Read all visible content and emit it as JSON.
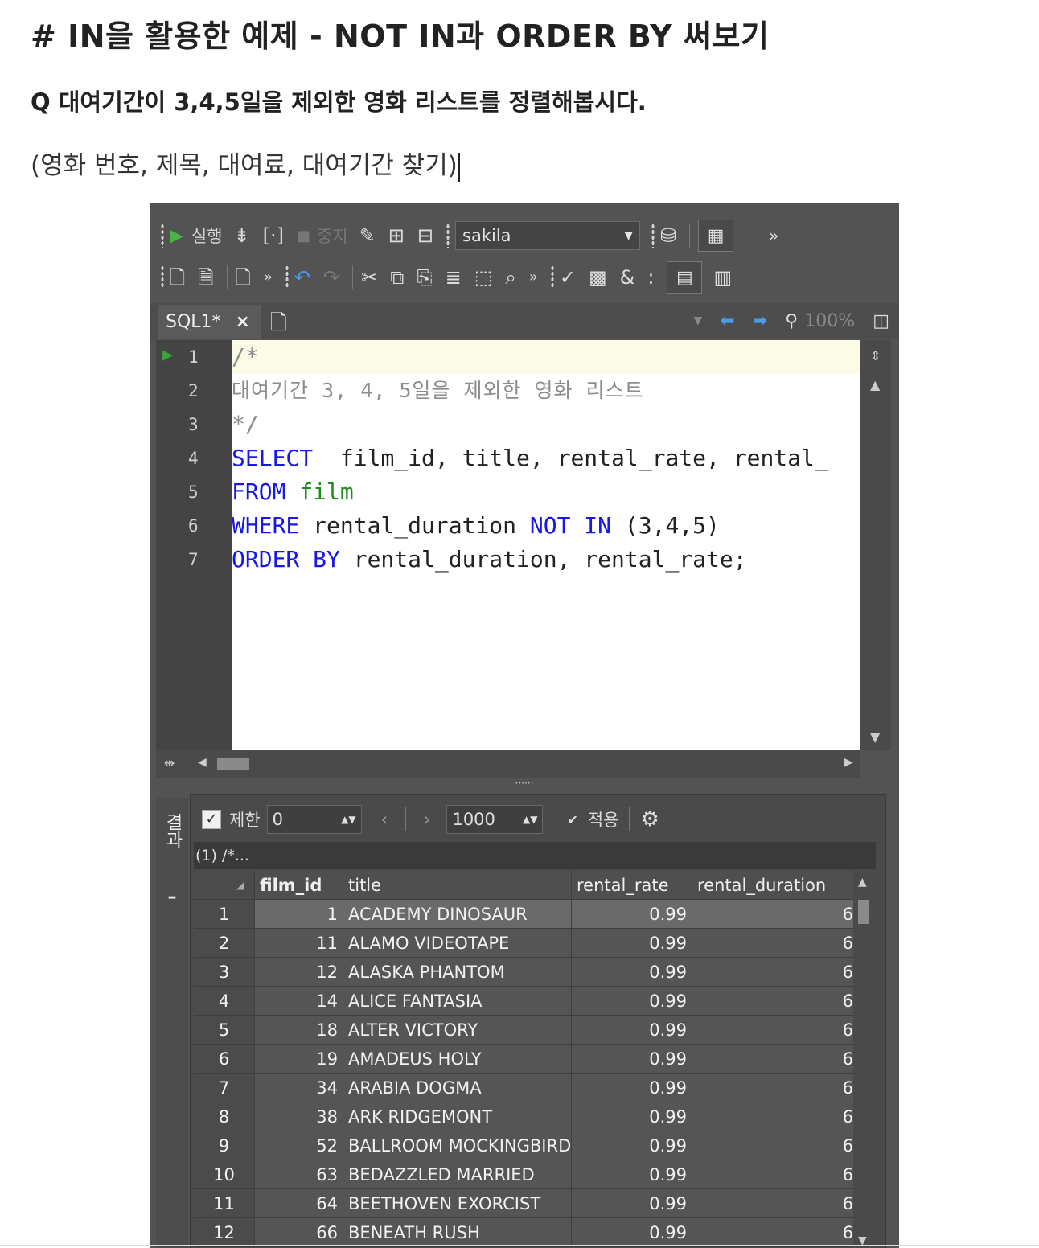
{
  "article": {
    "heading": "# IN을 활용한 예제 - NOT IN과 ORDER BY 써보기",
    "question": "Q 대여기간이 3,4,5일을 제외한 영화 리스트를 정렬해봅시다.",
    "note": "(영화 번호, 제목, 대여료, 대여기간 찾기)"
  },
  "toolbar": {
    "run_label": "실행",
    "stop_label": "중지",
    "database": "sakila",
    "more": "»"
  },
  "tabs": {
    "sql_tab": "SQL1*",
    "close": "×",
    "zoom": "100%"
  },
  "editor": {
    "line_numbers": [
      "1",
      "2",
      "3",
      "4",
      "5",
      "6",
      "7"
    ],
    "lines": {
      "l1": "/*",
      "l2": "대여기간 3, 4, 5일을 제외한 영화 리스트",
      "l3": "*/",
      "l4_kw": "SELECT",
      "l4_rest": "  film_id, title, rental_rate, rental_",
      "l5_kw": "FROM",
      "l5_tbl": "film",
      "l6_kw1": "WHERE",
      "l6_mid": " rental_duration ",
      "l6_kw2": "NOT IN",
      "l6_rest": " (3,4,5)",
      "l7_kw": "ORDER BY",
      "l7_rest": " rental_duration, rental_rate;"
    }
  },
  "results": {
    "side_tab": "결과",
    "limit_label": "제한",
    "limit_value": "0",
    "page_size": "1000",
    "apply_label": "적용",
    "query_tab": "(1) /*...",
    "columns": [
      "",
      "film_id",
      "title",
      "rental_rate",
      "rental_duration"
    ],
    "rows": [
      [
        "1",
        "1",
        "ACADEMY DINOSAUR",
        "0.99",
        "6"
      ],
      [
        "2",
        "11",
        "ALAMO VIDEOTAPE",
        "0.99",
        "6"
      ],
      [
        "3",
        "12",
        "ALASKA PHANTOM",
        "0.99",
        "6"
      ],
      [
        "4",
        "14",
        "ALICE FANTASIA",
        "0.99",
        "6"
      ],
      [
        "5",
        "18",
        "ALTER VICTORY",
        "0.99",
        "6"
      ],
      [
        "6",
        "19",
        "AMADEUS HOLY",
        "0.99",
        "6"
      ],
      [
        "7",
        "34",
        "ARABIA DOGMA",
        "0.99",
        "6"
      ],
      [
        "8",
        "38",
        "ARK RIDGEMONT",
        "0.99",
        "6"
      ],
      [
        "9",
        "52",
        "BALLROOM MOCKINGBIRD",
        "0.99",
        "6"
      ],
      [
        "10",
        "63",
        "BEDAZZLED MARRIED",
        "0.99",
        "6"
      ],
      [
        "11",
        "64",
        "BEETHOVEN EXORCIST",
        "0.99",
        "6"
      ],
      [
        "12",
        "66",
        "BENEATH RUSH",
        "0.99",
        "6"
      ]
    ]
  }
}
